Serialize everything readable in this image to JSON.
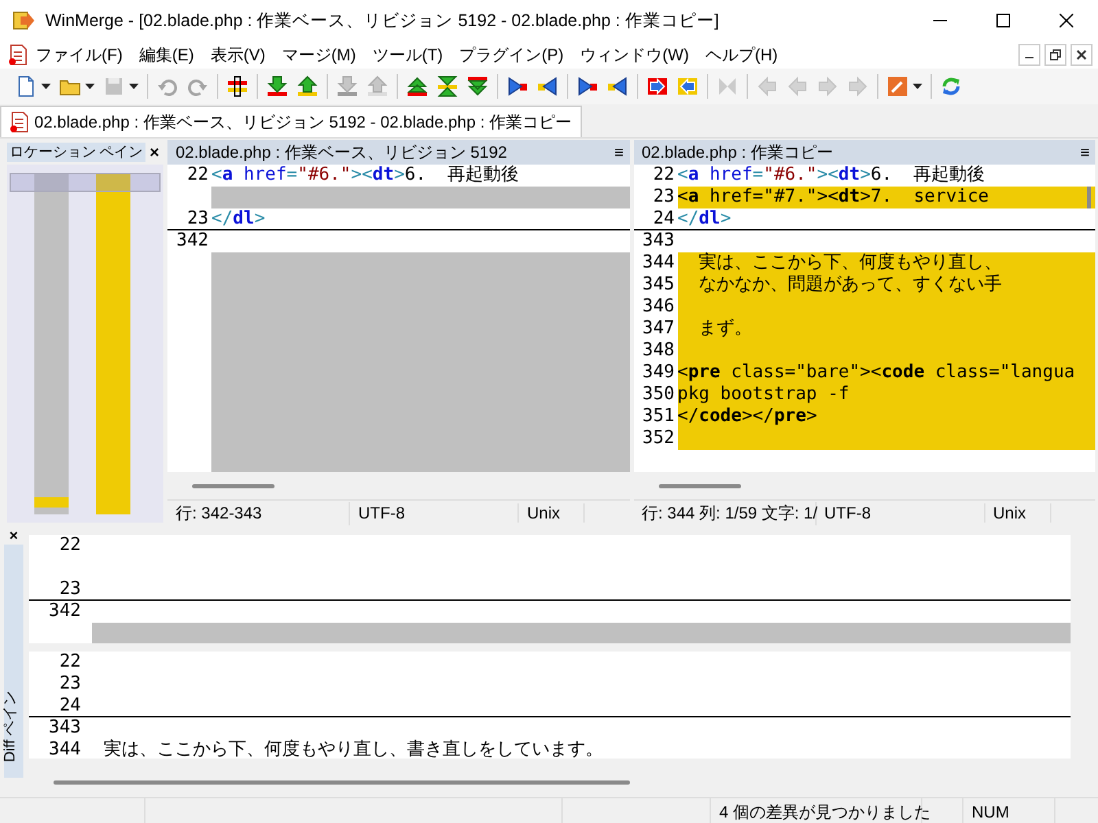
{
  "window": {
    "title": "WinMerge - [02.blade.php : 作業ベース、リビジョン 5192 - 02.blade.php : 作業コピー]"
  },
  "menu": [
    "ファイル(F)",
    "編集(E)",
    "表示(V)",
    "マージ(M)",
    "ツール(T)",
    "プラグイン(P)",
    "ウィンドウ(W)",
    "ヘルプ(H)"
  ],
  "toolbar": [
    {
      "kind": "new",
      "disabled": false,
      "dropdown": true
    },
    {
      "kind": "open",
      "disabled": false,
      "dropdown": true
    },
    {
      "kind": "save",
      "disabled": true,
      "dropdown": true
    },
    {
      "kind": "separator"
    },
    {
      "kind": "undo",
      "disabled": true,
      "dropdown": false
    },
    {
      "kind": "redo",
      "disabled": true,
      "dropdown": false
    },
    {
      "kind": "separator"
    },
    {
      "kind": "options",
      "disabled": false,
      "dropdown": false
    },
    {
      "kind": "separator"
    },
    {
      "kind": "next",
      "disabled": false,
      "dropdown": false
    },
    {
      "kind": "prev",
      "disabled": false,
      "dropdown": false
    },
    {
      "kind": "separator"
    },
    {
      "kind": "next",
      "disabled": true,
      "dropdown": false
    },
    {
      "kind": "prev",
      "disabled": true,
      "dropdown": false
    },
    {
      "kind": "separator"
    },
    {
      "kind": "first",
      "disabled": false,
      "dropdown": false
    },
    {
      "kind": "current",
      "disabled": false,
      "dropdown": false
    },
    {
      "kind": "last",
      "disabled": false,
      "dropdown": false
    },
    {
      "kind": "separator"
    },
    {
      "kind": "copy-right",
      "disabled": false,
      "dropdown": false
    },
    {
      "kind": "copy-left",
      "disabled": false,
      "dropdown": false
    },
    {
      "kind": "separator"
    },
    {
      "kind": "copy-right",
      "disabled": false,
      "dropdown": false
    },
    {
      "kind": "copy-left",
      "disabled": false,
      "dropdown": false
    },
    {
      "kind": "separator"
    },
    {
      "kind": "all-right",
      "disabled": false,
      "dropdown": false
    },
    {
      "kind": "all-left",
      "disabled": false,
      "dropdown": false
    },
    {
      "kind": "separator"
    },
    {
      "kind": "merge",
      "disabled": true,
      "dropdown": false
    },
    {
      "kind": "separator"
    },
    {
      "kind": "nav-left",
      "disabled": true,
      "dropdown": false
    },
    {
      "kind": "nav-left",
      "disabled": true,
      "dropdown": false
    },
    {
      "kind": "nav-right",
      "disabled": true,
      "dropdown": false
    },
    {
      "kind": "nav-right",
      "disabled": true,
      "dropdown": false
    },
    {
      "kind": "separator"
    },
    {
      "kind": "tools",
      "disabled": false,
      "dropdown": true
    },
    {
      "kind": "separator"
    },
    {
      "kind": "refresh",
      "disabled": false,
      "dropdown": false
    }
  ],
  "tabs": [
    {
      "label": "02.blade.php : 作業ベース、リビジョン 5192 - 02.blade.php : 作業コピー",
      "selected": true
    }
  ],
  "location_pane": {
    "title": "ロケーション ペイン",
    "close": "×"
  },
  "panes": [
    {
      "title": "02.blade.php : 作業ベース、リビジョン 5192",
      "menu": "≡",
      "filler_gap": true,
      "scrollbar": false,
      "lines": [
        {
          "num": "22",
          "kind": "same",
          "rule_below": false,
          "tokens": [
            {
              "t": "<",
              "kind": "br"
            },
            {
              "t": "a",
              "kind": "tag"
            },
            {
              "t": " href",
              "kind": "attr"
            },
            {
              "t": "=",
              "kind": "br"
            },
            {
              "t": "\"#6.\"",
              "kind": "str"
            },
            {
              "t": ">",
              "kind": "br"
            },
            {
              "t": "<",
              "kind": "br"
            },
            {
              "t": "dt",
              "kind": "tag"
            },
            {
              "t": ">",
              "kind": "br"
            },
            {
              "t": "6.  再起動後",
              "kind": "text"
            }
          ]
        },
        {
          "kind": "gap"
        },
        {
          "num": "23",
          "kind": "same",
          "rule_below": true,
          "tokens": [
            {
              "t": "</",
              "kind": "br"
            },
            {
              "t": "dl",
              "kind": "tag"
            },
            {
              "t": ">",
              "kind": "br"
            }
          ]
        },
        {
          "num": "342",
          "kind": "same",
          "rule_below": false
        }
      ],
      "status": [
        "行: 342-343",
        "UTF-8",
        "Unix"
      ]
    },
    {
      "title": "02.blade.php : 作業コピー",
      "menu": "≡",
      "filler_gap": false,
      "scrollbar": true,
      "lines": [
        {
          "num": "22",
          "kind": "same",
          "rule_below": false,
          "tokens": [
            {
              "t": "<",
              "kind": "br"
            },
            {
              "t": "a",
              "kind": "tag"
            },
            {
              "t": " href",
              "kind": "attr"
            },
            {
              "t": "=",
              "kind": "br"
            },
            {
              "t": "\"#6.\"",
              "kind": "str"
            },
            {
              "t": ">",
              "kind": "br"
            },
            {
              "t": "<",
              "kind": "br"
            },
            {
              "t": "dt",
              "kind": "tag"
            },
            {
              "t": ">",
              "kind": "br"
            },
            {
              "t": "6.  再起動後",
              "kind": "text"
            }
          ]
        },
        {
          "num": "23",
          "kind": "diff",
          "rule_below": false,
          "tokens": [
            {
              "t": "<",
              "kind": "br"
            },
            {
              "t": "a",
              "kind": "tag"
            },
            {
              "t": " href",
              "kind": "attr"
            },
            {
              "t": "=",
              "kind": "br"
            },
            {
              "t": "\"#7.\"",
              "kind": "str"
            },
            {
              "t": ">",
              "kind": "br"
            },
            {
              "t": "<",
              "kind": "br"
            },
            {
              "t": "dt",
              "kind": "tag"
            },
            {
              "t": ">",
              "kind": "br"
            },
            {
              "t": "7.  service",
              "kind": "text"
            }
          ]
        },
        {
          "num": "24",
          "kind": "same",
          "rule_below": true,
          "tokens": [
            {
              "t": "</",
              "kind": "br"
            },
            {
              "t": "dl",
              "kind": "tag"
            },
            {
              "t": ">",
              "kind": "br"
            }
          ]
        },
        {
          "num": "343",
          "kind": "same",
          "rule_below": false
        },
        {
          "num": "344",
          "kind": "diff",
          "rule_below": false,
          "tokens": [
            {
              "t": "  実は、ここから下、何度もやり直し、",
              "kind": "text"
            }
          ]
        },
        {
          "num": "345",
          "kind": "diff",
          "rule_below": false,
          "tokens": [
            {
              "t": "  なかなか、問題があって、すくない手",
              "kind": "text"
            }
          ]
        },
        {
          "num": "346",
          "kind": "diff",
          "rule_below": false
        },
        {
          "num": "347",
          "kind": "diff",
          "rule_below": false,
          "tokens": [
            {
              "t": "  まず。",
              "kind": "text"
            }
          ]
        },
        {
          "num": "348",
          "kind": "diff",
          "rule_below": false
        },
        {
          "num": "349",
          "kind": "diff",
          "rule_below": false,
          "tokens": [
            {
              "t": "<",
              "kind": "br"
            },
            {
              "t": "pre",
              "kind": "tag"
            },
            {
              "t": " class=\"bare\">",
              "kind": "text"
            },
            {
              "t": "<",
              "kind": "br"
            },
            {
              "t": "code",
              "kind": "tag"
            },
            {
              "t": " class=\"langua",
              "kind": "text"
            }
          ]
        },
        {
          "num": "350",
          "kind": "diff",
          "rule_below": false,
          "tokens": [
            {
              "t": "pkg bootstrap -f",
              "kind": "text"
            }
          ]
        },
        {
          "num": "351",
          "kind": "diff",
          "rule_below": false,
          "tokens": [
            {
              "t": "</",
              "kind": "br"
            },
            {
              "t": "code",
              "kind": "tag"
            },
            {
              "t": "></",
              "kind": "br"
            },
            {
              "t": "pre",
              "kind": "tag"
            },
            {
              "t": ">",
              "kind": "br"
            }
          ]
        },
        {
          "num": "352",
          "kind": "diff",
          "rule_below": false
        }
      ],
      "status": [
        "行: 344  列: 1/59  文字: 1/",
        "UTF-8",
        "Unix"
      ]
    }
  ],
  "diff_pane": {
    "title": "Diff ペイン",
    "close": "×",
    "panels": [
      {
        "lines": [
          {
            "num": "22",
            "kind": "same",
            "rule_below": false
          },
          {
            "kind": "same",
            "rule_below": false
          },
          {
            "num": "23",
            "kind": "same",
            "rule_below": true
          },
          {
            "num": "342",
            "kind": "same",
            "rule_below": false
          },
          {
            "kind": "gap"
          }
        ]
      },
      {
        "lines": [
          {
            "num": "22",
            "kind": "same",
            "rule_below": false
          },
          {
            "num": "23",
            "kind": "same",
            "rule_below": false
          },
          {
            "num": "24",
            "kind": "same",
            "rule_below": true
          },
          {
            "num": "343",
            "kind": "same",
            "rule_below": false
          },
          {
            "num": "344",
            "kind": "same",
            "rule_below": false,
            "tokens": [
              {
                "t": "  実は、ここから下、何度もやり直し、書き直しをしています。",
                "kind": "text"
              }
            ]
          }
        ]
      }
    ]
  },
  "status_bar": {
    "message": "4 個の差異が見つかりました",
    "num_lock": "NUM"
  }
}
